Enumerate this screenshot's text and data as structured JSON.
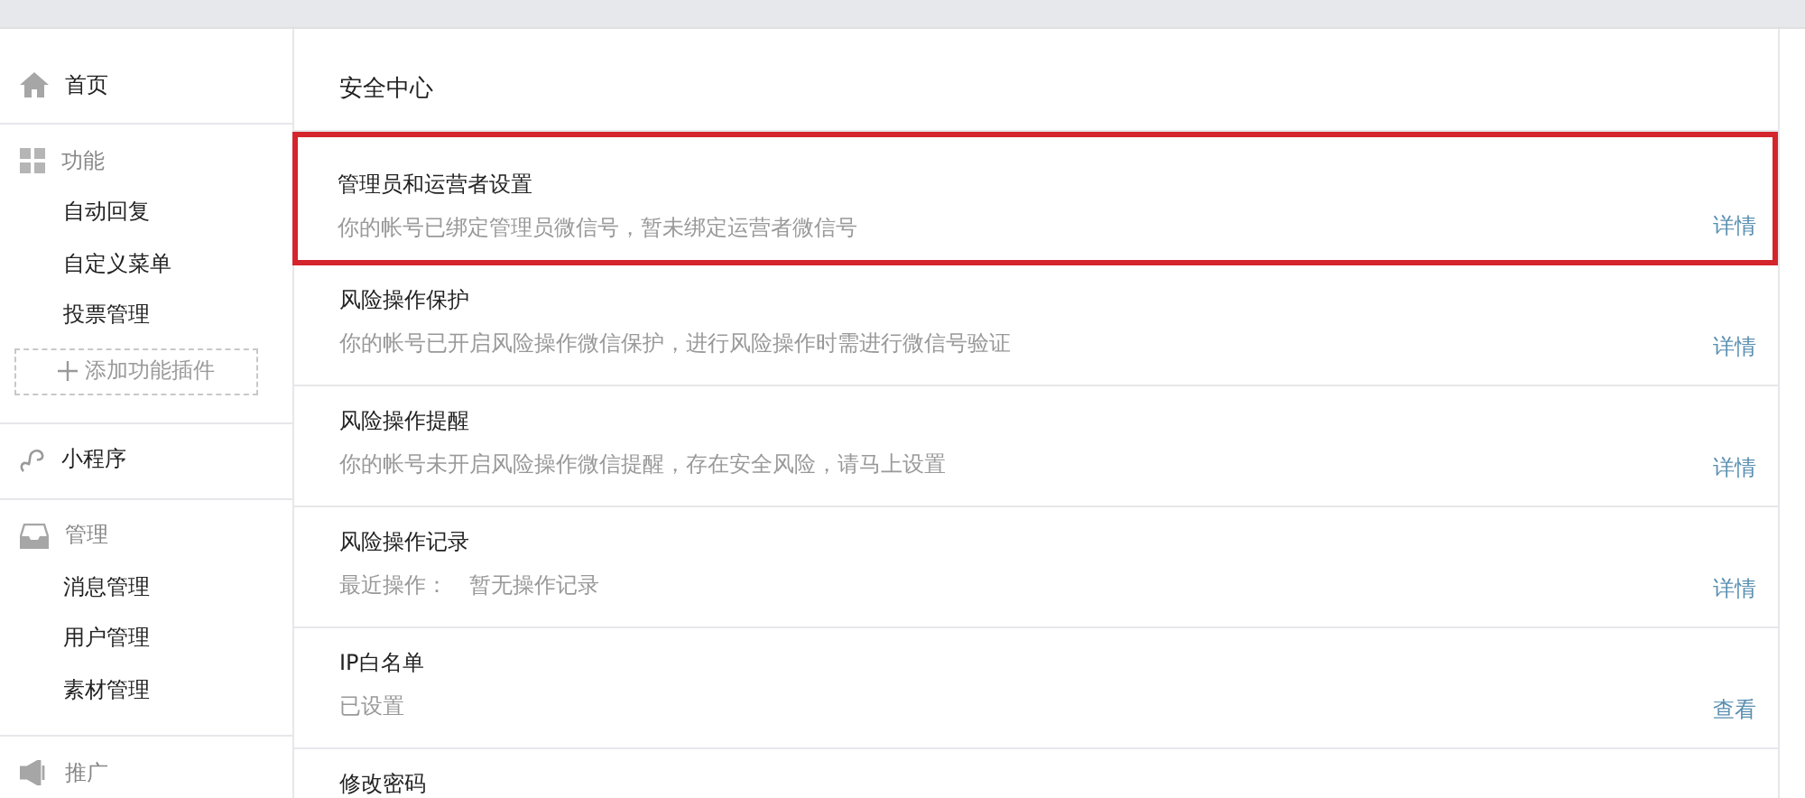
{
  "sidebar": {
    "sections": [
      {
        "label": "首页"
      },
      {
        "label": "功能",
        "items": [
          "自动回复",
          "自定义菜单",
          "投票管理"
        ],
        "add_button": "添加功能插件"
      },
      {
        "label": "小程序"
      },
      {
        "label": "管理",
        "items": [
          "消息管理",
          "用户管理",
          "素材管理"
        ]
      },
      {
        "label": "推广"
      }
    ]
  },
  "main": {
    "title": "安全中心",
    "rows": [
      {
        "title": "管理员和运营者设置",
        "description": "你的帐号已绑定管理员微信号，暂未绑定运营者微信号",
        "link": "详情",
        "highlighted": true
      },
      {
        "title": "风险操作保护",
        "description": "你的帐号已开启风险操作微信保护，进行风险操作时需进行微信号验证",
        "link": "详情",
        "highlighted": false
      },
      {
        "title": "风险操作提醒",
        "description": "你的帐号未开启风险操作微信提醒，存在安全风险，请马上设置",
        "link": "详情",
        "highlighted": false
      },
      {
        "title": "风险操作记录",
        "description": "最近操作：　暂无操作记录",
        "link": "详情",
        "highlighted": false
      },
      {
        "title": "IP白名单",
        "description": "已设置",
        "link": "查看",
        "highlighted": false
      },
      {
        "title": "修改密码",
        "highlighted": false
      }
    ]
  }
}
